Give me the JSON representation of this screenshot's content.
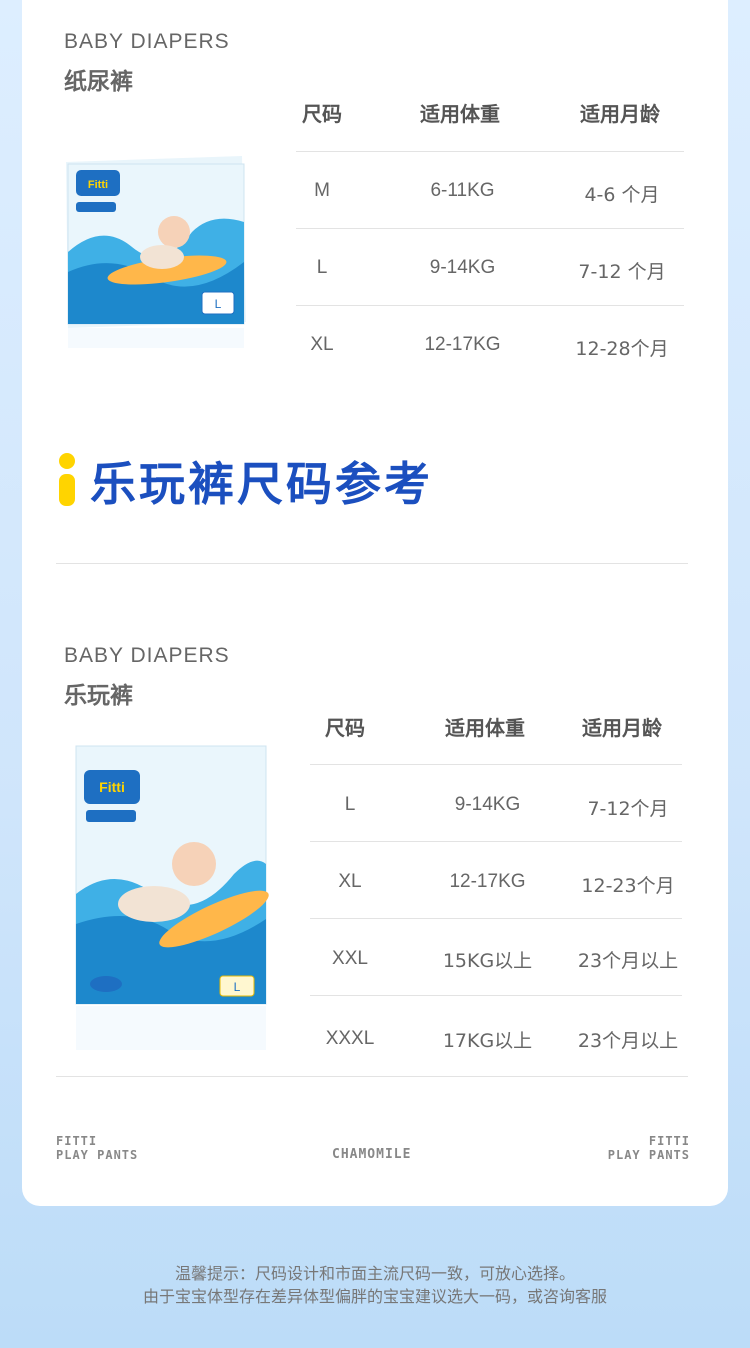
{
  "section1": {
    "brand_en": "BABY DIAPERS",
    "brand_cn": "纸尿裤",
    "headers": [
      "尺码",
      "适用体重",
      "适用月龄"
    ],
    "rows": [
      [
        "M",
        "6-11KG",
        "4-6 个月"
      ],
      [
        "L",
        "9-14KG",
        "7-12 个月"
      ],
      [
        "XL",
        "12-17KG",
        "12-28个月"
      ]
    ],
    "product_size_badge": "L"
  },
  "section_title": "乐玩裤尺码参考",
  "section2": {
    "brand_en": "BABY DIAPERS",
    "brand_cn": "乐玩裤",
    "headers": [
      "尺码",
      "适用体重",
      "适用月龄"
    ],
    "rows": [
      [
        "L",
        "9-14KG",
        "7-12个月"
      ],
      [
        "XL",
        "12-17KG",
        "12-23个月"
      ],
      [
        "XXL",
        "15KG以上",
        "23个月以上"
      ],
      [
        "XXXL",
        "17KG以上",
        "23个月以上"
      ]
    ],
    "product_brand": "Fitti",
    "product_size_badge": "L"
  },
  "footer": {
    "left": [
      "FITTI",
      "PLAY PANTS"
    ],
    "center": "CHAMOMILE",
    "right": [
      "FITTI",
      "PLAY PANTS"
    ]
  },
  "tips": [
    "温馨提示：尺码设计和市面主流尺码一致，可放心选择。",
    "由于宝宝体型存在差异体型偏胖的宝宝建议选大一码，或咨询客服"
  ],
  "colors": {
    "title_blue": "#1b4fbf",
    "accent_yellow": "#ffd400",
    "background": "#d6e9fc"
  }
}
